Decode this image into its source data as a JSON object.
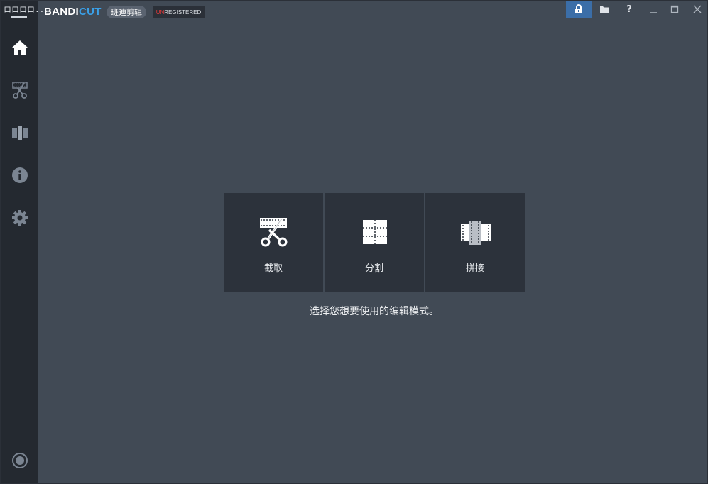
{
  "app": {
    "brand_part1": "BANDI",
    "brand_part2": "CUT",
    "chinese_name": "班迪剪辑",
    "reg_prefix": "UN",
    "reg_rest": "REGISTERED",
    "menu_text": "ロロロロ..."
  },
  "titlebar": {
    "help_label": "?"
  },
  "sidebar": {
    "items": [
      {
        "icon": "home-icon"
      },
      {
        "icon": "trim-icon"
      },
      {
        "icon": "join-icon"
      },
      {
        "icon": "info-icon"
      },
      {
        "icon": "gear-icon"
      },
      {
        "icon": "record-icon"
      }
    ]
  },
  "modes": [
    {
      "label": "截取",
      "icon": "trim-icon"
    },
    {
      "label": "分割",
      "icon": "split-icon"
    },
    {
      "label": "拼接",
      "icon": "join-icon"
    }
  ],
  "prompt": "选择您想要使用的编辑模式。",
  "colors": {
    "background": "#414a55",
    "sidebar": "#242930",
    "tile": "#2c323b",
    "accent": "#3aa0e8",
    "lock_button": "#3b6ea8",
    "unregistered_red": "#e23a3a"
  }
}
